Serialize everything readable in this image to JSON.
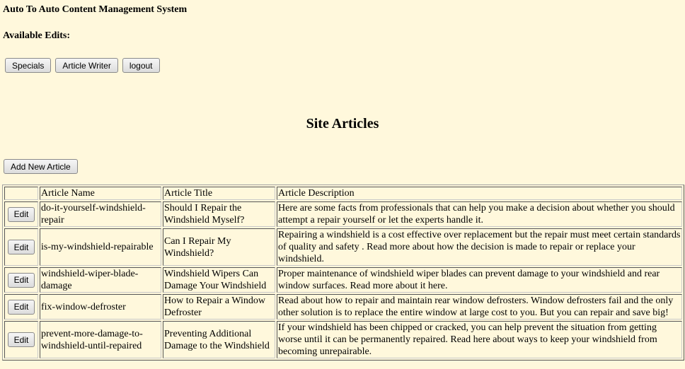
{
  "app": {
    "title": "Auto To Auto Content Management System",
    "edits_label": "Available Edits:"
  },
  "nav": {
    "buttons": [
      "Specials",
      "Article Writer",
      "logout"
    ]
  },
  "page": {
    "heading": "Site Articles",
    "add_button": "Add New Article"
  },
  "table": {
    "headers": [
      "",
      "Article Name",
      "Article Title",
      "Article Description"
    ],
    "edit_label": "Edit",
    "rows": [
      {
        "name": "do-it-yourself-windshield-repair",
        "title": "Should I Repair the Windshield Myself?",
        "description": "Here are some facts from professionals that can help you make a decision about whether you should attempt a repair yourself or let the experts handle it."
      },
      {
        "name": "is-my-windshield-repairable",
        "title": "Can I Repair My Windshield?",
        "description": "Repairing a windshield is a cost effective over replacement but the repair must meet certain standards of quality and safety . Read more about how the decision is made to repair or replace your windshield."
      },
      {
        "name": "windshield-wiper-blade-damage",
        "title": "Windshield Wipers Can Damage Your Windshield",
        "description": "Proper maintenance of windshield wiper blades can prevent damage to your windshield and rear window surfaces. Read more about it here."
      },
      {
        "name": "fix-window-defroster",
        "title": "How to Repair a Window Defroster",
        "description": "Read about how to repair and maintain rear window defrosters. Window defrosters fail and the only other solution is to replace the entire window at large cost to you. But you can repair and save big!"
      },
      {
        "name": "prevent-more-damage-to-windshield-until-repaired",
        "title": "Preventing Additional Damage to the Windshield",
        "description": "If your windshield has been chipped or cracked, you can help prevent the situation from getting worse until it can be permanently repaired. Read here about ways to keep your windshield from becoming unrepairable."
      }
    ]
  }
}
